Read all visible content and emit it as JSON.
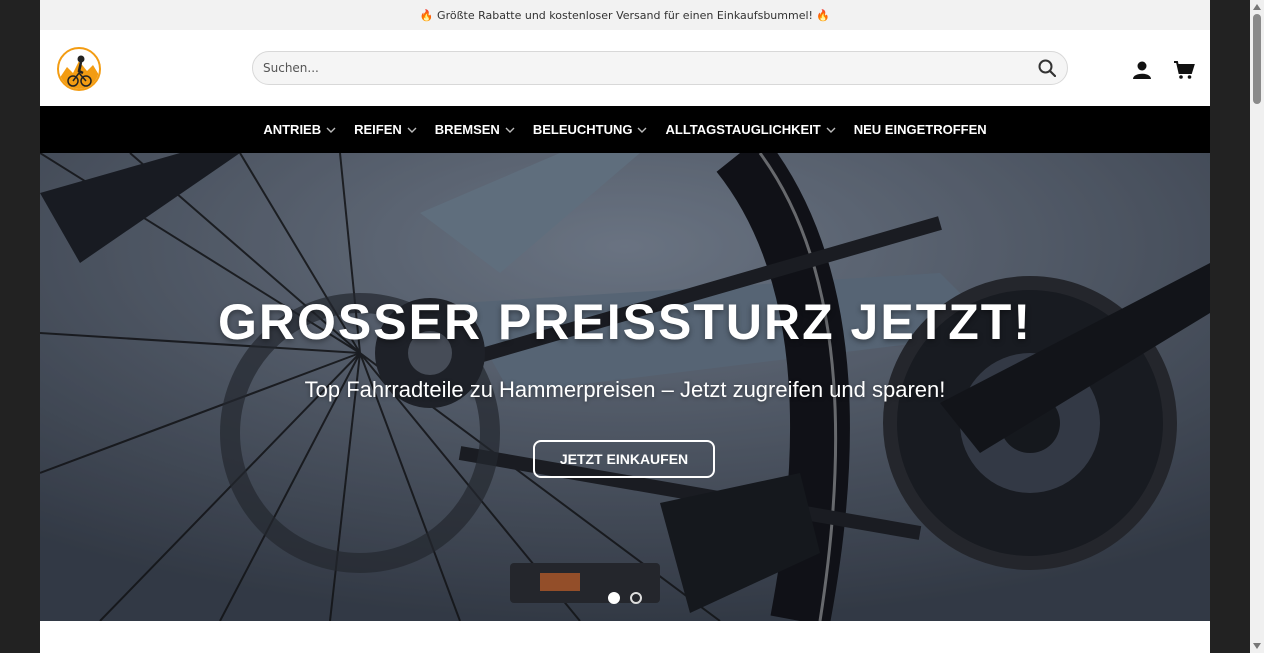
{
  "topbar": {
    "promo_text": "🔥 Größte Rabatte und kostenloser Versand für einen Einkaufsbummel! 🔥"
  },
  "header": {
    "logo_icon": "cyclist-logo-icon",
    "search": {
      "placeholder": "Suchen...",
      "value": ""
    },
    "account_icon": "user-icon",
    "cart_icon": "cart-icon"
  },
  "nav": {
    "items": [
      {
        "label": "ANTRIEB",
        "has_dropdown": true
      },
      {
        "label": "REIFEN",
        "has_dropdown": true
      },
      {
        "label": "BREMSEN",
        "has_dropdown": true
      },
      {
        "label": "BELEUCHTUNG",
        "has_dropdown": true
      },
      {
        "label": "ALLTAGSTAUGLICHKEIT",
        "has_dropdown": true
      },
      {
        "label": "NEU EINGETROFFEN",
        "has_dropdown": false
      }
    ]
  },
  "hero": {
    "title": "GROSSER PREISSTURZ JETZT!",
    "subtitle": "Top Fahrradteile zu Hammerpreisen – Jetzt zugreifen und sparen!",
    "cta_label": "JETZT EINKAUFEN",
    "slides_total": 2,
    "active_slide": 1
  },
  "colors": {
    "topbar_bg": "#f2f2f2",
    "nav_bg": "#000000",
    "accent_logo": "#f39c12",
    "page_bg": "#222222"
  }
}
